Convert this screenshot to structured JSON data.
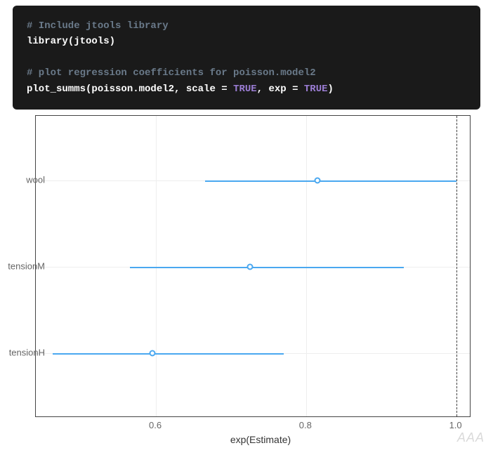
{
  "code": {
    "comment1": "# Include jtools library",
    "line1a": "library",
    "line1b": "(jtools)",
    "comment2": "# plot regression coefficients for poisson.model2",
    "line2a": "plot_summs",
    "line2b": "(poisson.model2, scale = ",
    "true1": "TRUE",
    "line2c": ", exp = ",
    "true2": "TRUE",
    "line2d": ")"
  },
  "chart_data": {
    "type": "dotplot",
    "title": "",
    "xlabel": "exp(Estimate)",
    "ylabel": "",
    "xticks": [
      0.6,
      0.8,
      1.0
    ],
    "xlim": [
      0.44,
      1.02
    ],
    "reference_line": 1.0,
    "categories": [
      "wool",
      "tensionM",
      "tensionH"
    ],
    "series": [
      {
        "name": "wool",
        "estimate": 0.815,
        "ci_low": 0.665,
        "ci_high": 1.0
      },
      {
        "name": "tensionM",
        "estimate": 0.725,
        "ci_low": 0.565,
        "ci_high": 0.93
      },
      {
        "name": "tensionH",
        "estimate": 0.595,
        "ci_low": 0.462,
        "ci_high": 0.77
      }
    ]
  },
  "watermark": "AAA",
  "colors": {
    "code_bg": "#1a1a1a",
    "accent": "#4aa8f0"
  }
}
